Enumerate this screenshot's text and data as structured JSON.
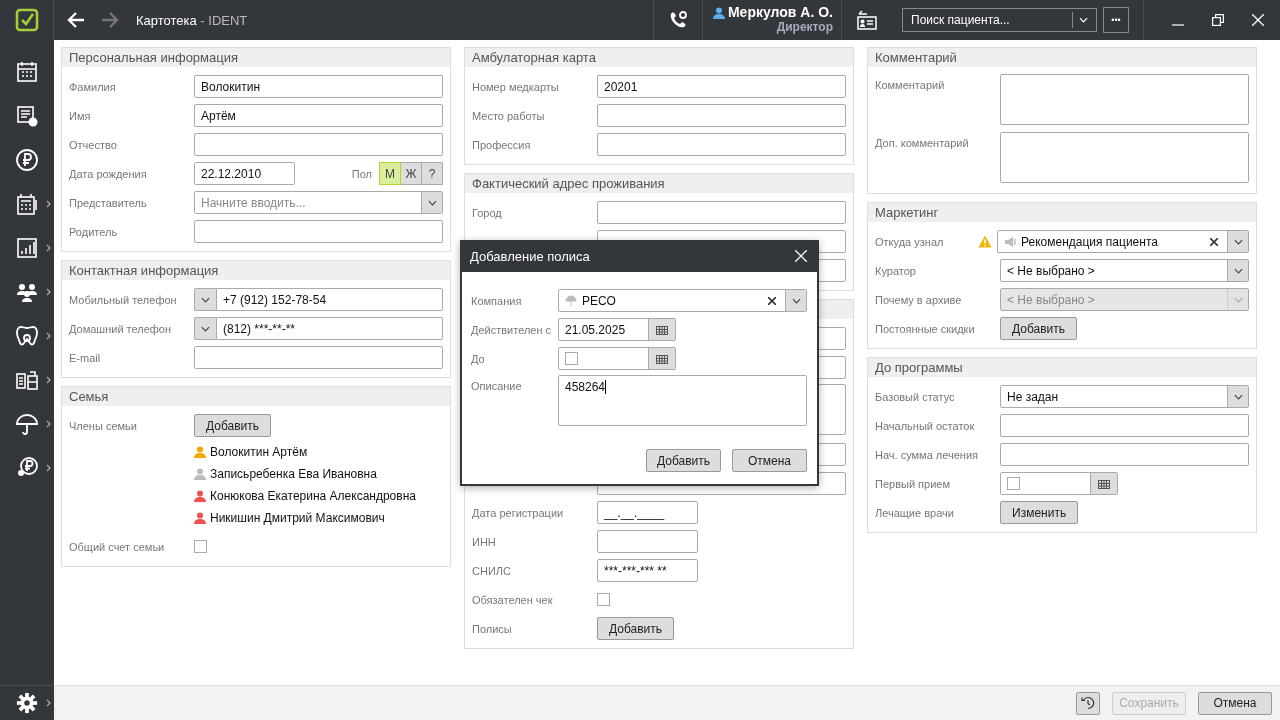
{
  "titlebar": {
    "title": "Картотека",
    "separator": "-",
    "app": "IDENT",
    "user": {
      "name": "Меркулов А. О.",
      "role": "Директор"
    },
    "search": {
      "placeholder": "Поиск пациента..."
    },
    "more": "•••"
  },
  "sidebar": {
    "items": [
      {
        "kind": "schedule",
        "submenu": false
      },
      {
        "kind": "tasks",
        "submenu": false
      },
      {
        "kind": "payments",
        "submenu": false
      },
      {
        "kind": "cashbox",
        "submenu": true
      },
      {
        "kind": "reports",
        "submenu": true
      },
      {
        "kind": "people",
        "submenu": true
      },
      {
        "kind": "tooth",
        "submenu": true
      },
      {
        "kind": "stock",
        "submenu": true
      },
      {
        "kind": "insurance",
        "submenu": true
      },
      {
        "kind": "debt",
        "submenu": true
      }
    ],
    "settings": {
      "submenu": true
    }
  },
  "columns": [
    {
      "sections": [
        {
          "title": "Персональная информация",
          "rows": [
            {
              "kind": "text",
              "label": "Фамилия",
              "value": "Волокитин"
            },
            {
              "kind": "text",
              "label": "Имя",
              "value": "Артём"
            },
            {
              "kind": "text",
              "label": "Отчество"
            },
            {
              "kind": "date_gender",
              "label": "Дата рождения",
              "value": "22.12.2010",
              "gender_label": "Пол",
              "options": [
                {
                  "label": "М",
                  "selected": true
                },
                {
                  "label": "Ж",
                  "selected": false
                },
                {
                  "label": "?",
                  "selected": false
                }
              ]
            },
            {
              "kind": "select",
              "label": "Представитель",
              "placeholder": "Начните вводить..."
            },
            {
              "kind": "text",
              "label": "Родитель"
            }
          ]
        },
        {
          "title": "Контактная информация",
          "rows": [
            {
              "kind": "phone",
              "label": "Мобильный телефон",
              "value": "+7 (912) 152-78-54"
            },
            {
              "kind": "phone",
              "label": "Домашний телефон",
              "value": "(812) ***-**-**"
            },
            {
              "kind": "text",
              "label": "E-mail"
            }
          ]
        },
        {
          "title": "Семья",
          "rows": [
            {
              "kind": "button",
              "label": "Члены семьи",
              "button": "Добавить"
            },
            {
              "kind": "members",
              "items": [
                {
                  "name": "Волокитин Артём",
                  "color": "#f5a800"
                },
                {
                  "name": "Записьребенка Ева Ивановна",
                  "color": "#bbbbbb"
                },
                {
                  "name": "Конюкова Екатерина Александровна",
                  "color": "#f0524f"
                },
                {
                  "name": "Никишин Дмитрий Максимович",
                  "color": "#f0524f"
                }
              ]
            },
            {
              "kind": "checkbox",
              "label": "Общий счет семьи",
              "checked": false
            }
          ]
        }
      ]
    },
    {
      "sections": [
        {
          "title": "Амбулаторная карта",
          "rows": [
            {
              "kind": "text",
              "label": "Номер медкарты",
              "value": "20201"
            },
            {
              "kind": "text",
              "label": "Место работы"
            },
            {
              "kind": "text",
              "label": "Профессия"
            }
          ]
        },
        {
          "title": "Фактический адрес проживания",
          "rows": [
            {
              "kind": "text",
              "label": "Город"
            },
            {
              "kind": "covered"
            },
            {
              "kind": "covered"
            }
          ]
        },
        {
          "rows": [
            {
              "kind": "covered"
            },
            {
              "kind": "covered"
            },
            {
              "kind": "covered_area"
            },
            {
              "kind": "covered"
            },
            {
              "kind": "covered"
            },
            {
              "kind": "date",
              "label": "Дата регистрации",
              "value": "__.__.____"
            },
            {
              "kind": "text",
              "label": "ИНН",
              "short": true
            },
            {
              "kind": "text",
              "label": "СНИЛС",
              "value": "***-***-*** **",
              "short": true
            },
            {
              "kind": "checkbox",
              "label": "Обязателен чек",
              "checked": false
            },
            {
              "kind": "button",
              "label": "Полисы",
              "button": "Добавить"
            }
          ]
        }
      ]
    },
    {
      "sections": [
        {
          "title": "Комментарий",
          "rows": [
            {
              "kind": "area",
              "label": "Комментарий"
            },
            {
              "kind": "area",
              "label": "Доп. комментарий"
            }
          ]
        },
        {
          "title": "Маркетинг",
          "rows": [
            {
              "kind": "source_select",
              "label": "Откуда узнал",
              "value": "Рекомендация пациента",
              "warning": true,
              "clearable": true
            },
            {
              "kind": "select",
              "label": "Куратор",
              "value": "< Не выбрано >"
            },
            {
              "kind": "select",
              "label": "Почему в архиве",
              "value": "< Не выбрано >",
              "disabled": true
            },
            {
              "kind": "button",
              "label": "Постоянные скидки",
              "button": "Добавить"
            }
          ]
        },
        {
          "title": "До программы",
          "rows": [
            {
              "kind": "select",
              "label": "Базовый статус",
              "value": "Не задан"
            },
            {
              "kind": "text",
              "label": "Начальный остаток"
            },
            {
              "kind": "text",
              "label": "Нач. сумма лечения"
            },
            {
              "kind": "date",
              "label": "Первый прием",
              "checked": false,
              "calendar": true
            },
            {
              "kind": "button",
              "label": "Лечащие врачи",
              "button": "Изменить"
            }
          ]
        }
      ]
    }
  ],
  "dialog": {
    "title": "Добавление полиса",
    "rows": [
      {
        "kind": "company_select",
        "label": "Компания",
        "value": "РЕСО",
        "clearable": true
      },
      {
        "kind": "date",
        "label": "Действителен с",
        "value": "21.05.2025",
        "calendar": true
      },
      {
        "kind": "date",
        "label": "До",
        "checked": false,
        "calendar": true
      },
      {
        "kind": "area",
        "label": "Описание",
        "value": "458264"
      }
    ],
    "buttons": [
      "Добавить",
      "Отмена"
    ]
  },
  "footer": {
    "buttons": [
      {
        "kind": "history",
        "disabled": false
      },
      {
        "kind": "save",
        "label": "Сохранить",
        "disabled": true
      },
      {
        "kind": "cancel",
        "label": "Отмена",
        "disabled": false
      }
    ]
  }
}
